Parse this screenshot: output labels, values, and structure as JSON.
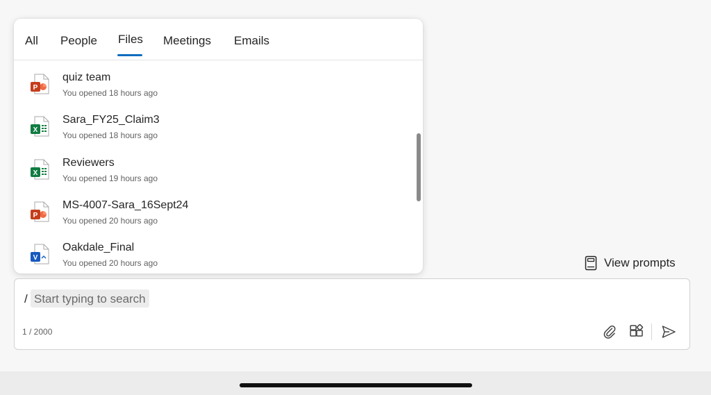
{
  "colors": {
    "accent": "#0f6cbd",
    "powerpoint": "#c43e1c",
    "excel": "#107c41",
    "word": "#185abd"
  },
  "tabs": [
    {
      "label": "All"
    },
    {
      "label": "People"
    },
    {
      "label": "Files",
      "active": true
    },
    {
      "label": "Meetings"
    },
    {
      "label": "Emails"
    }
  ],
  "files": [
    {
      "name": "quiz team",
      "meta": "You opened 18 hours ago",
      "icon": "powerpoint-file-icon",
      "letter": "P"
    },
    {
      "name": "Sara_FY25_Claim3",
      "meta": "You opened 18 hours ago",
      "icon": "excel-file-icon",
      "letter": "X"
    },
    {
      "name": "Reviewers",
      "meta": "You opened 19 hours ago",
      "icon": "excel-file-icon",
      "letter": "X"
    },
    {
      "name": "MS-4007-Sara_16Sept24",
      "meta": "You opened 20 hours ago",
      "icon": "powerpoint-file-icon",
      "letter": "P"
    },
    {
      "name": "Oakdale_Final",
      "meta": "You opened 20 hours ago",
      "icon": "word-file-icon",
      "letter": "V"
    }
  ],
  "view_prompts": {
    "label": "View prompts",
    "icon": "notebook-icon"
  },
  "composer": {
    "slash": "/",
    "placeholder": "Start typing to search",
    "char_count": "1 / 2000",
    "icons": [
      "paperclip-icon",
      "add-apps-icon",
      "send-icon"
    ]
  }
}
